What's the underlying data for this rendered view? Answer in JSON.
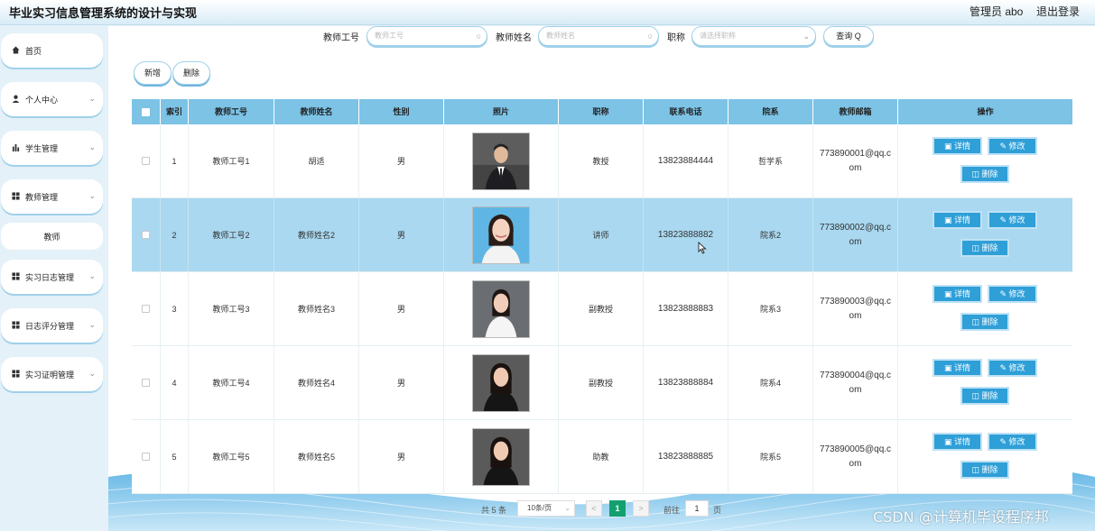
{
  "header": {
    "title": "毕业实习信息管理系统的设计与实现",
    "user": "管理员 abo",
    "logout": "退出登录"
  },
  "sidebar": {
    "items": [
      {
        "label": "首页",
        "icon": "home-icon"
      },
      {
        "label": "个人中心",
        "icon": "person-icon"
      },
      {
        "label": "学生管理",
        "icon": "bar-chart-icon"
      },
      {
        "label": "教师管理",
        "icon": "grid-icon"
      },
      {
        "label": "教师",
        "icon": ""
      },
      {
        "label": "实习日志管理",
        "icon": "grid-icon"
      },
      {
        "label": "日志评分管理",
        "icon": "grid-icon"
      },
      {
        "label": "实习证明管理",
        "icon": "grid-icon"
      }
    ]
  },
  "search": {
    "teacher_id_label": "教师工号",
    "teacher_id_placeholder": "教师工号",
    "teacher_name_label": "教师姓名",
    "teacher_name_placeholder": "教师姓名",
    "title_label": "职称",
    "title_placeholder": "请选择职称",
    "query_button": "查询 Q"
  },
  "toolbar": {
    "add_label": "新增",
    "delete_label": "删除"
  },
  "table": {
    "columns": [
      "",
      "索引",
      "教师工号",
      "教师姓名",
      "性别",
      "照片",
      "职称",
      "联系电话",
      "院系",
      "教师邮箱",
      "操作"
    ],
    "rows": [
      {
        "index": "1",
        "teacher_id": "教师工号1",
        "name": "胡适",
        "gender": "男",
        "title": "教授",
        "phone": "13823884444",
        "dept": "哲学系",
        "email": "773890001@qq.com",
        "selected": false
      },
      {
        "index": "2",
        "teacher_id": "教师工号2",
        "name": "教师姓名2",
        "gender": "男",
        "title": "讲师",
        "phone": "13823888882",
        "dept": "院系2",
        "email": "773890002@qq.com",
        "selected": true
      },
      {
        "index": "3",
        "teacher_id": "教师工号3",
        "name": "教师姓名3",
        "gender": "男",
        "title": "副教授",
        "phone": "13823888883",
        "dept": "院系3",
        "email": "773890003@qq.com",
        "selected": false
      },
      {
        "index": "4",
        "teacher_id": "教师工号4",
        "name": "教师姓名4",
        "gender": "男",
        "title": "副教授",
        "phone": "13823888884",
        "dept": "院系4",
        "email": "773890004@qq.com",
        "selected": false
      },
      {
        "index": "5",
        "teacher_id": "教师工号5",
        "name": "教师姓名5",
        "gender": "男",
        "title": "助教",
        "phone": "13823888885",
        "dept": "院系5",
        "email": "773890005@qq.com",
        "selected": false
      }
    ],
    "actions": {
      "detail": "详情",
      "edit": "修改",
      "delete": "删除"
    }
  },
  "pagination": {
    "total": "共 5 条",
    "page_size": "10条/页",
    "prev": "<",
    "current": "1",
    "next": ">",
    "goto_label": "前往",
    "goto_value": "1",
    "page_suffix": "页"
  },
  "watermark": "CSDN @计算机毕设程序邦",
  "colors": {
    "accent": "#2f9fd8",
    "header_row": "#7cc3e6",
    "selected_row": "#a9d8f0",
    "current_page": "#13a06f",
    "sidebar_bg": "#e4f1f8"
  }
}
